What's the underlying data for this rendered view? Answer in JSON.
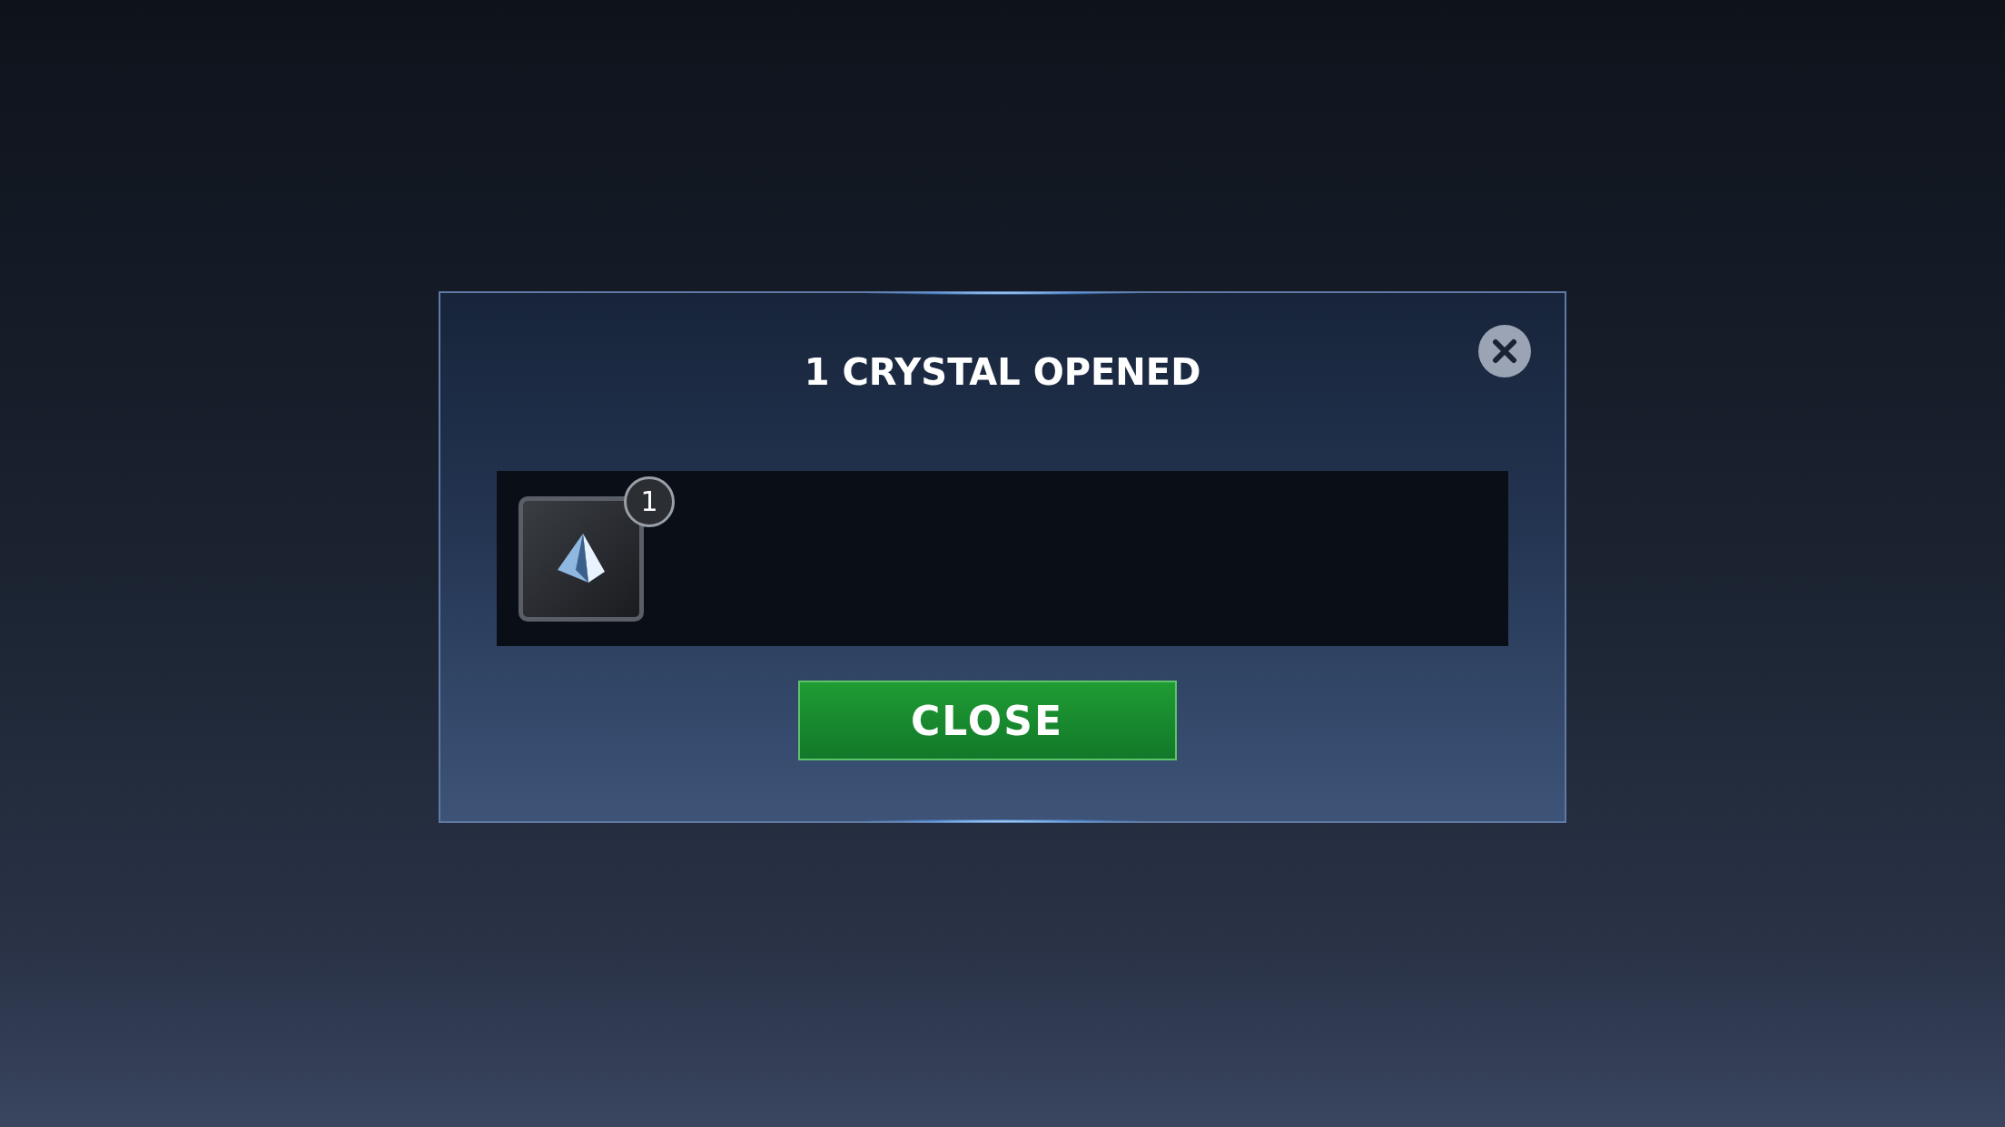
{
  "dialog": {
    "title": "1 CRYSTAL OPENED",
    "rewards": [
      {
        "count": "1"
      }
    ],
    "button": "CLOSE"
  }
}
